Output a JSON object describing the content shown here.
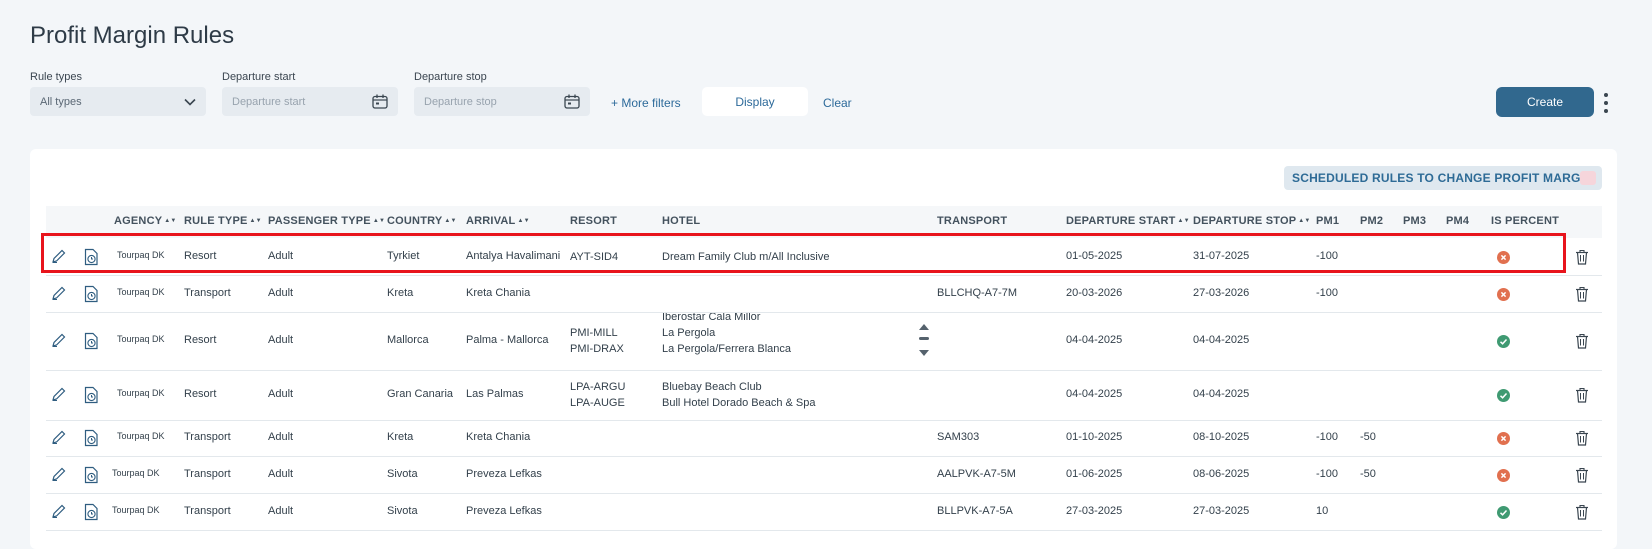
{
  "title": "Profit Margin Rules",
  "filters": {
    "rule_types_label": "Rule types",
    "rule_types_value": "All types",
    "departure_start_label": "Departure start",
    "departure_start_placeholder": "Departure start",
    "departure_stop_label": "Departure stop",
    "departure_stop_placeholder": "Departure stop",
    "more_filters": "+ More filters",
    "display": "Display",
    "clear": "Clear"
  },
  "actions": {
    "create": "Create"
  },
  "scheduled_badge": "SCHEDULED RULES TO CHANGE PROFIT MARGIN",
  "columns": [
    "AGENCY",
    "RULE TYPE",
    "PASSENGER TYPE",
    "COUNTRY",
    "ARRIVAL",
    "RESORT",
    "HOTEL",
    "TRANSPORT",
    "DEPARTURE START",
    "DEPARTURE STOP",
    "PM1",
    "PM2",
    "PM3",
    "PM4",
    "IS PERCENT"
  ],
  "rows": [
    {
      "agency": "Tourpaq DK",
      "rule_type": "Resort",
      "passenger": "Adult",
      "country": "Tyrkiet",
      "arrival": "Antalya Havalimani",
      "resort": [
        "AYT-SID4"
      ],
      "hotel": [
        "Dream Family Club m/All Inclusive"
      ],
      "transport": "",
      "dep_start": "01-05-2025",
      "dep_stop": "31-07-2025",
      "pm1": "-100",
      "pm2": "",
      "pm3": "",
      "pm4": "",
      "is_percent": false
    },
    {
      "agency": "Tourpaq DK",
      "rule_type": "Transport",
      "passenger": "Adult",
      "country": "Kreta",
      "arrival": "Kreta Chania",
      "resort": [],
      "hotel": [],
      "transport": "BLLCHQ-A7-7M",
      "dep_start": "20-03-2026",
      "dep_stop": "27-03-2026",
      "pm1": "-100",
      "pm2": "",
      "pm3": "",
      "pm4": "",
      "is_percent": false
    },
    {
      "agency": "Tourpaq DK",
      "rule_type": "Resort",
      "passenger": "Adult",
      "country": "Mallorca",
      "arrival": "Palma - Mallorca",
      "resort": [
        "PMI-MILL",
        "PMI-DRAX"
      ],
      "hotel": [
        "Iberostar Cala Millor",
        "La Pergola",
        "La Pergola/Ferrera Blanca"
      ],
      "transport": "",
      "dep_start": "04-04-2025",
      "dep_stop": "04-04-2025",
      "pm1": "",
      "pm2": "",
      "pm3": "",
      "pm4": "",
      "is_percent": true
    },
    {
      "agency": "Tourpaq DK",
      "rule_type": "Resort",
      "passenger": "Adult",
      "country": "Gran Canaria",
      "arrival": "Las Palmas",
      "resort": [
        "LPA-ARGU",
        "LPA-AUGE"
      ],
      "hotel": [
        "Bluebay Beach Club",
        "Bull Hotel Dorado Beach & Spa"
      ],
      "transport": "",
      "dep_start": "04-04-2025",
      "dep_stop": "04-04-2025",
      "pm1": "",
      "pm2": "",
      "pm3": "",
      "pm4": "",
      "is_percent": true
    },
    {
      "agency": "Tourpaq DK",
      "rule_type": "Transport",
      "passenger": "Adult",
      "country": "Kreta",
      "arrival": "Kreta Chania",
      "resort": [],
      "hotel": [],
      "transport": "SAM303",
      "dep_start": "01-10-2025",
      "dep_stop": "08-10-2025",
      "pm1": "-100",
      "pm2": "-50",
      "pm3": "",
      "pm4": "",
      "is_percent": false
    },
    {
      "agency": "Tourpaq DK",
      "rule_type": "Transport",
      "passenger": "Adult",
      "country": "Sivota",
      "arrival": "Preveza Lefkas",
      "resort": [],
      "hotel": [],
      "transport": "AALPVK-A7-5M",
      "dep_start": "01-06-2025",
      "dep_stop": "08-06-2025",
      "pm1": "-100",
      "pm2": "-50",
      "pm3": "",
      "pm4": "",
      "is_percent": false
    },
    {
      "agency": "Tourpaq DK",
      "rule_type": "Transport",
      "passenger": "Adult",
      "country": "Sivota",
      "arrival": "Preveza Lefkas",
      "resort": [],
      "hotel": [],
      "transport": "BLLPVK-A7-5A",
      "dep_start": "27-03-2025",
      "dep_stop": "27-03-2025",
      "pm1": "10",
      "pm2": "",
      "pm3": "",
      "pm4": "",
      "is_percent": true
    }
  ],
  "colors": {
    "accent": "#31688e",
    "link": "#2d6a9a",
    "bad": "#e1704f",
    "good": "#3f9a72",
    "highlight": "#e8141c"
  }
}
